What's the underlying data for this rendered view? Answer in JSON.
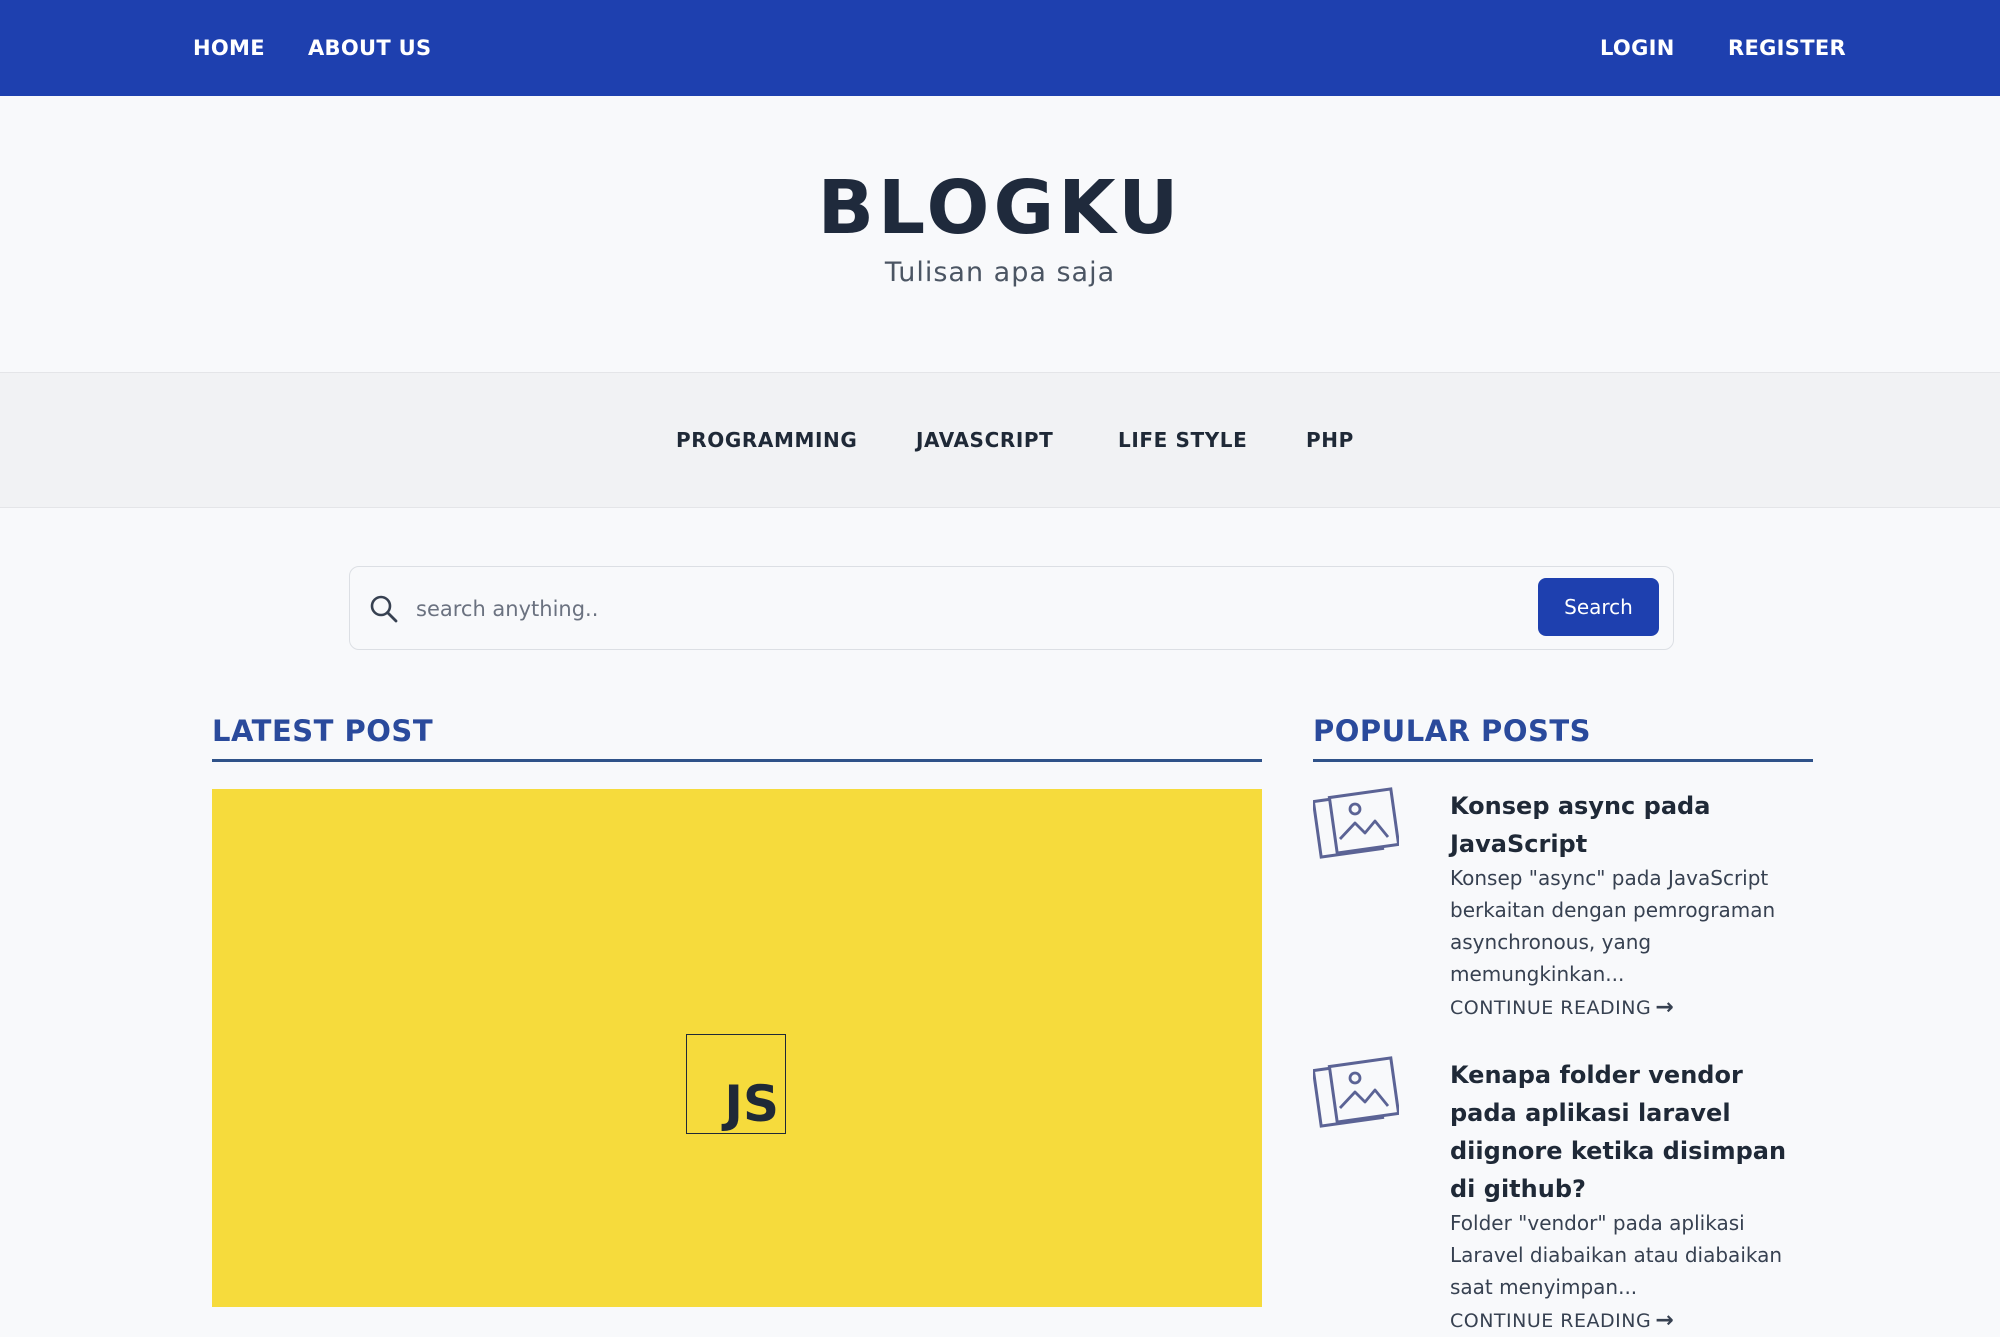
{
  "topnav": {
    "left": [
      "HOME",
      "ABOUT US"
    ],
    "right": [
      "LOGIN",
      "REGISTER"
    ]
  },
  "brand": {
    "title": "BLOGKU",
    "tagline": "Tulisan apa saja"
  },
  "categories": [
    "PROGRAMMING",
    "JAVASCRIPT",
    "LIFE STYLE",
    "PHP"
  ],
  "search": {
    "placeholder": "search anything..",
    "button_label": "Search",
    "icon": "search-icon"
  },
  "latest": {
    "heading": "LATEST POST",
    "hero_logo_text": "JS",
    "hero_color": "#f6db3c"
  },
  "popular": {
    "heading": "POPULAR POSTS",
    "thumb_icon": "image-placeholder-icon",
    "items": [
      {
        "title": "Konsep async pada JavaScript",
        "excerpt": "Konsep \"async\" pada JavaScript berkaitan dengan pemrograman asynchronous, yang memungkinkan...",
        "link": "CONTINUE READING"
      },
      {
        "title": "Kenapa folder vendor pada aplikasi laravel diignore ketika disimpan di github?",
        "excerpt": "Folder \"vendor\" pada aplikasi Laravel diabaikan atau diabaikan saat menyimpan...",
        "link": "CONTINUE READING"
      }
    ]
  },
  "colors": {
    "primary": "#1e40af",
    "heading_blue": "#2a4a9c",
    "background": "#f8f9fb"
  }
}
